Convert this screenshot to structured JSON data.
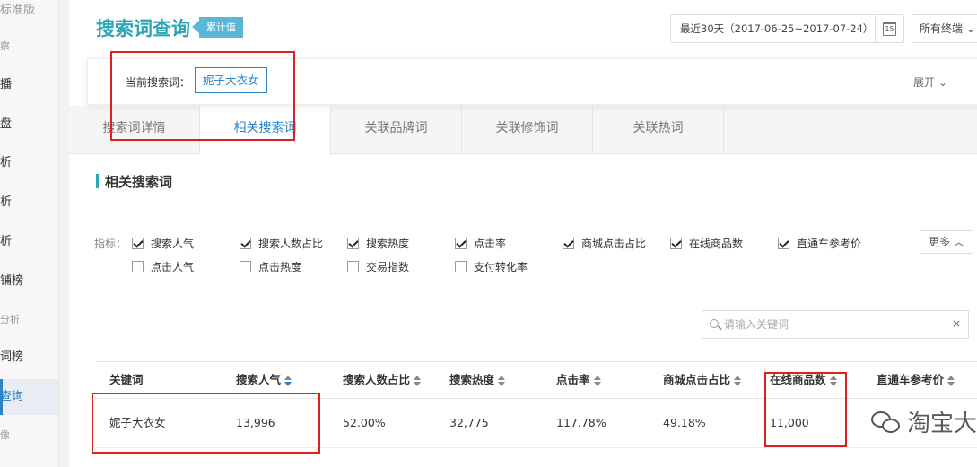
{
  "sidebar": {
    "items": [
      {
        "label": "标准版",
        "style": "head"
      },
      {
        "label": "察",
        "style": "small"
      },
      {
        "label": "播",
        "style": "normal"
      },
      {
        "label": "盘",
        "style": "normal"
      },
      {
        "label": "析",
        "style": "normal"
      },
      {
        "label": "析",
        "style": "normal"
      },
      {
        "label": "析",
        "style": "normal"
      },
      {
        "label": "铺榜",
        "style": "normal"
      },
      {
        "label": "分析",
        "style": "small"
      },
      {
        "label": "词榜",
        "style": "normal"
      },
      {
        "label": "查询",
        "style": "active"
      },
      {
        "label": "像",
        "style": "small"
      }
    ]
  },
  "header": {
    "title": "搜索词查询",
    "tag": "累计值",
    "date_range": "最近30天（2017-06-25~2017-07-24）",
    "calendar_day": "15",
    "terminal": "所有终端",
    "terminal_chevron": "⌄"
  },
  "current_search": {
    "label": "当前搜索词：",
    "keyword": "妮子大衣女",
    "expand": "展开 ⌄"
  },
  "tabs": [
    {
      "label": "搜索词详情",
      "active": false
    },
    {
      "label": "相关搜索词",
      "active": true
    },
    {
      "label": "关联品牌词",
      "active": false
    },
    {
      "label": "关联修饰词",
      "active": false
    },
    {
      "label": "关联热词",
      "active": false
    }
  ],
  "section": {
    "title": "相关搜索词"
  },
  "indicators": {
    "label": "指标：",
    "items": [
      {
        "label": "搜索人气",
        "checked": true
      },
      {
        "label": "搜索人数占比",
        "checked": true
      },
      {
        "label": "搜索热度",
        "checked": true
      },
      {
        "label": "点击率",
        "checked": true
      },
      {
        "label": "商城点击占比",
        "checked": true
      },
      {
        "label": "在线商品数",
        "checked": true
      },
      {
        "label": "直通车参考价",
        "checked": true
      },
      {
        "label": "点击人气",
        "checked": false
      },
      {
        "label": "点击热度",
        "checked": false
      },
      {
        "label": "交易指数",
        "checked": false
      },
      {
        "label": "支付转化率",
        "checked": false
      }
    ],
    "more": "更多 ︿"
  },
  "search": {
    "placeholder": "请输入关键词",
    "clear": "×"
  },
  "table": {
    "columns": [
      "关键词",
      "搜索人气",
      "搜索人数占比",
      "搜索热度",
      "点击率",
      "商城点击占比",
      "在线商品数",
      "直通车参考价"
    ],
    "rows": [
      [
        "妮子大衣女",
        "13,996",
        "52.00%",
        "32,775",
        "117.78%",
        "49.18%",
        "11,000",
        ""
      ]
    ]
  },
  "watermark": "淘宝大学",
  "colors": {
    "accent": "#2aa6b6",
    "link_blue": "#2d82c8",
    "highlight_red": "#e02020"
  }
}
